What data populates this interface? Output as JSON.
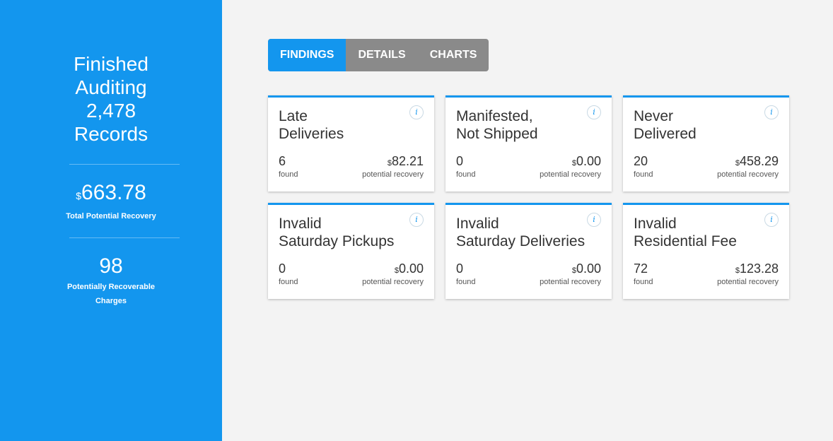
{
  "sidebar": {
    "title_lines": [
      "Finished",
      "Auditing",
      "2,478",
      "Records"
    ],
    "total_recovery": {
      "currency": "$",
      "amount": "663.78",
      "label": "Total Potential Recovery"
    },
    "charges": {
      "value": "98",
      "label": "Potentially Recoverable Charges"
    }
  },
  "tabs": [
    {
      "label": "FINDINGS",
      "active": true
    },
    {
      "label": "DETAILS",
      "active": false
    },
    {
      "label": "CHARTS",
      "active": false
    }
  ],
  "cards": [
    {
      "title_lines": [
        "Late",
        "Deliveries"
      ],
      "info": "i",
      "found": "6",
      "found_label": "found",
      "currency": "$",
      "amount": "82.21",
      "recovery_label": "potential recovery"
    },
    {
      "title_lines": [
        "Manifested,",
        "Not Shipped"
      ],
      "info": "i",
      "found": "0",
      "found_label": "found",
      "currency": "$",
      "amount": "0.00",
      "recovery_label": "potential recovery"
    },
    {
      "title_lines": [
        "Never",
        "Delivered"
      ],
      "info": "i",
      "found": "20",
      "found_label": "found",
      "currency": "$",
      "amount": "458.29",
      "recovery_label": "potential recovery"
    },
    {
      "title_lines": [
        "Invalid",
        "Saturday Pickups"
      ],
      "info": "i",
      "found": "0",
      "found_label": "found",
      "currency": "$",
      "amount": "0.00",
      "recovery_label": "potential recovery"
    },
    {
      "title_lines": [
        "Invalid",
        "Saturday Deliveries"
      ],
      "info": "i",
      "found": "0",
      "found_label": "found",
      "currency": "$",
      "amount": "0.00",
      "recovery_label": "potential recovery"
    },
    {
      "title_lines": [
        "Invalid",
        "Residential Fee"
      ],
      "info": "i",
      "found": "72",
      "found_label": "found",
      "currency": "$",
      "amount": "123.28",
      "recovery_label": "potential recovery"
    }
  ]
}
